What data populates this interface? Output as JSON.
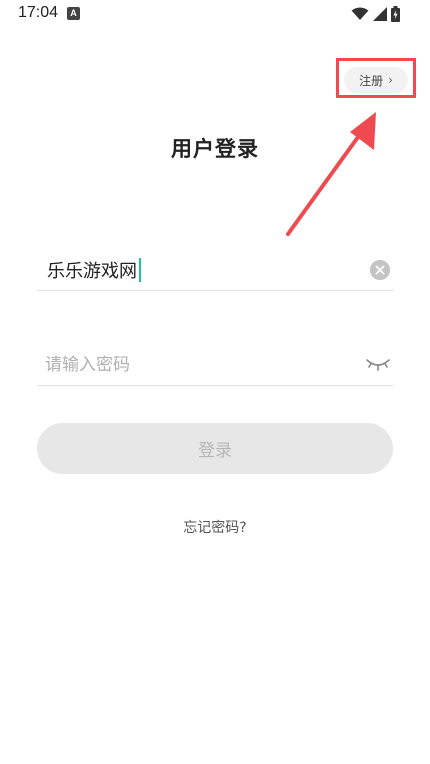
{
  "status_bar": {
    "time": "17:04",
    "notification_icon_label": "A",
    "icons": [
      "wifi-icon",
      "signal-icon",
      "battery-icon"
    ]
  },
  "header": {
    "register_label": "注册",
    "register_chevron": "›"
  },
  "annotation": {
    "color": "#ef4a4f"
  },
  "title": "用户登录",
  "username": {
    "value": "乐乐游戏网"
  },
  "password": {
    "placeholder": "请输入密码",
    "value": ""
  },
  "login_button": {
    "label": "登录"
  },
  "forgot_password": "忘记密码?",
  "colors": {
    "accent_caret": "#1fc39e",
    "button_bg": "#e7e7e7",
    "button_text": "#b6b6b6"
  }
}
